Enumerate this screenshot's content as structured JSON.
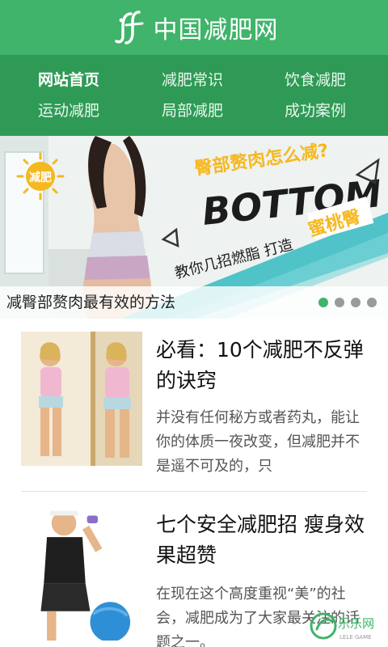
{
  "header": {
    "logo_text": "jf",
    "title": "中国减肥网"
  },
  "nav": {
    "items": [
      {
        "label": "网站首页",
        "active": true
      },
      {
        "label": "减肥常识",
        "active": false
      },
      {
        "label": "饮食减肥",
        "active": false
      },
      {
        "label": "运动减肥",
        "active": false
      },
      {
        "label": "局部减肥",
        "active": false
      },
      {
        "label": "成功案例",
        "active": false
      }
    ]
  },
  "banner": {
    "sun_label": "减肥",
    "question": "臀部赘肉怎么减?",
    "headline": "BOTTOM",
    "subline": "教你几招燃脂 打造",
    "highlight": "蜜桃臀",
    "caption": "减臀部赘肉最有效的方法",
    "slide_count": 4,
    "active_slide": 1
  },
  "articles": [
    {
      "title": "必看：10个减肥不反弹的诀窍",
      "description": "并没有任何秘方或者药丸，能让你的体质一夜改变，但减肥并不是遥不可及的，只",
      "thumbnail": "woman-measuring-waist-mirror"
    },
    {
      "title": "七个安全减肥招 瘦身效果超赞",
      "description": "在现在这个高度重视“美”的社会，减肥成为了大家最关注的话题之一。",
      "thumbnail": "woman-exercising-dumbbell-ball"
    }
  ],
  "watermark": {
    "text": "乐乐网",
    "subtext": "LELE GAME"
  },
  "colors": {
    "header_green": "#3fb46a",
    "nav_green": "#2f9a56",
    "banner_accent": "#4fc3c8",
    "banner_yellow": "#f5b820"
  }
}
